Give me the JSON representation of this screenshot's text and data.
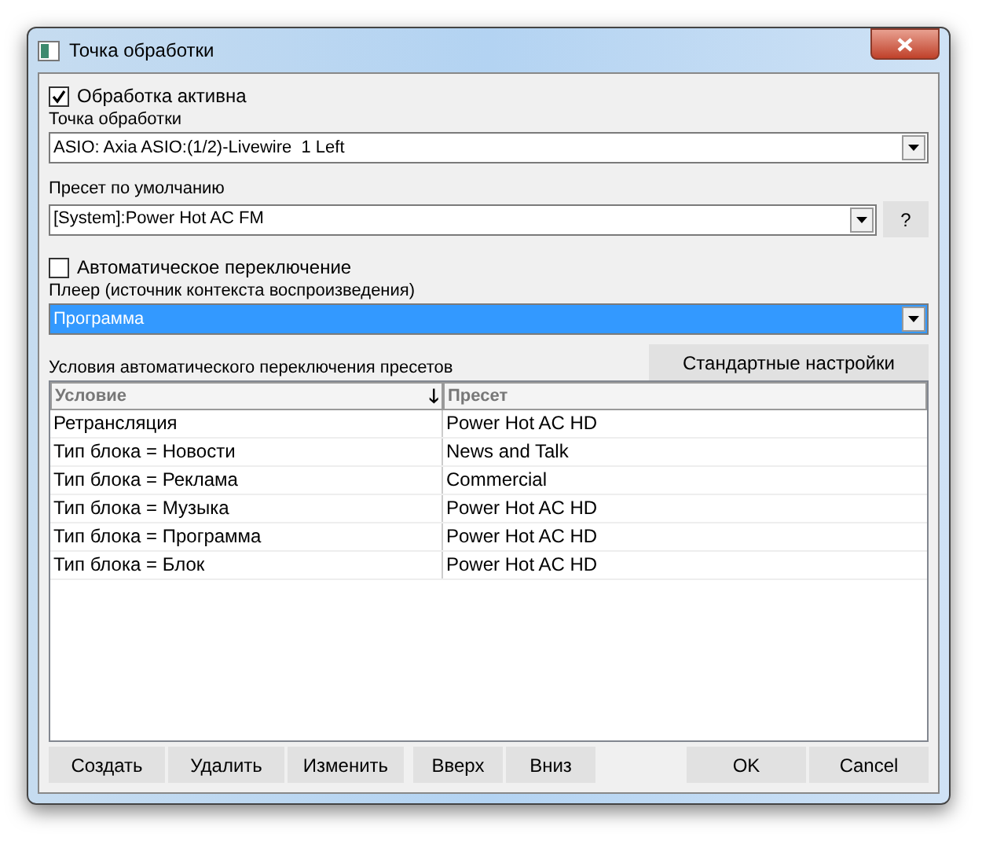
{
  "window": {
    "title": "Точка обработки"
  },
  "processing_active": {
    "label": "Обработка активна",
    "checked": true
  },
  "processing_point": {
    "label": "Точка обработки",
    "value": "ASIO: Axia ASIO:(1/2)-Livewire  1 Left"
  },
  "default_preset": {
    "label": "Пресет по умолчанию",
    "value": "[System]:Power Hot AC FM",
    "help_button": "?"
  },
  "auto_switch": {
    "label": "Автоматическое переключение",
    "checked": false
  },
  "player": {
    "label": "Плеер (источник контекста воспроизведения)",
    "value": "Программа",
    "focused": true
  },
  "conditions_label": "Условия автоматического переключения пресетов",
  "defaults_button": "Стандартные настройки",
  "table": {
    "columns": [
      {
        "label": "Условие",
        "sort_icon": "🡓"
      },
      {
        "label": "Пресет"
      }
    ],
    "rows": [
      [
        "Ретрансляция",
        "Power Hot AC HD"
      ],
      [
        "Тип блока = Новости",
        "News and Talk"
      ],
      [
        "Тип блока = Реклама",
        "Commercial"
      ],
      [
        "Тип блока = Музыка",
        "Power Hot AC HD"
      ],
      [
        "Тип блока = Программа",
        "Power Hot AC HD"
      ],
      [
        "Тип блока = Блок",
        "Power Hot AC HD"
      ]
    ]
  },
  "left_buttons": [
    [
      "Создать",
      "Удалить",
      "Изменить"
    ],
    [
      "Вверх",
      "Вниз"
    ]
  ],
  "right_buttons": [
    "OK",
    "Cancel"
  ]
}
